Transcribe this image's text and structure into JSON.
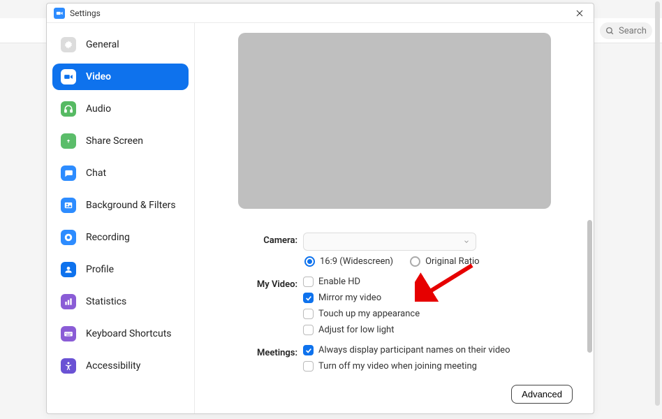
{
  "window": {
    "title": "Settings"
  },
  "search": {
    "placeholder": "Search"
  },
  "sidebar": {
    "items": [
      {
        "label": "General"
      },
      {
        "label": "Video"
      },
      {
        "label": "Audio"
      },
      {
        "label": "Share Screen"
      },
      {
        "label": "Chat"
      },
      {
        "label": "Background & Filters"
      },
      {
        "label": "Recording"
      },
      {
        "label": "Profile"
      },
      {
        "label": "Statistics"
      },
      {
        "label": "Keyboard Shortcuts"
      },
      {
        "label": "Accessibility"
      }
    ]
  },
  "labels": {
    "camera": "Camera:",
    "myvideo": "My Video:",
    "meetings": "Meetings:"
  },
  "options": {
    "ratio169": "16:9 (Widescreen)",
    "ratioOrig": "Original Ratio",
    "enableHD": "Enable HD",
    "mirror": "Mirror my video",
    "touchup": "Touch up my appearance",
    "lowlight": "Adjust for low light",
    "displayNames": "Always display participant names on their video",
    "turnOff": "Turn off my video when joining meeting"
  },
  "buttons": {
    "advanced": "Advanced"
  }
}
